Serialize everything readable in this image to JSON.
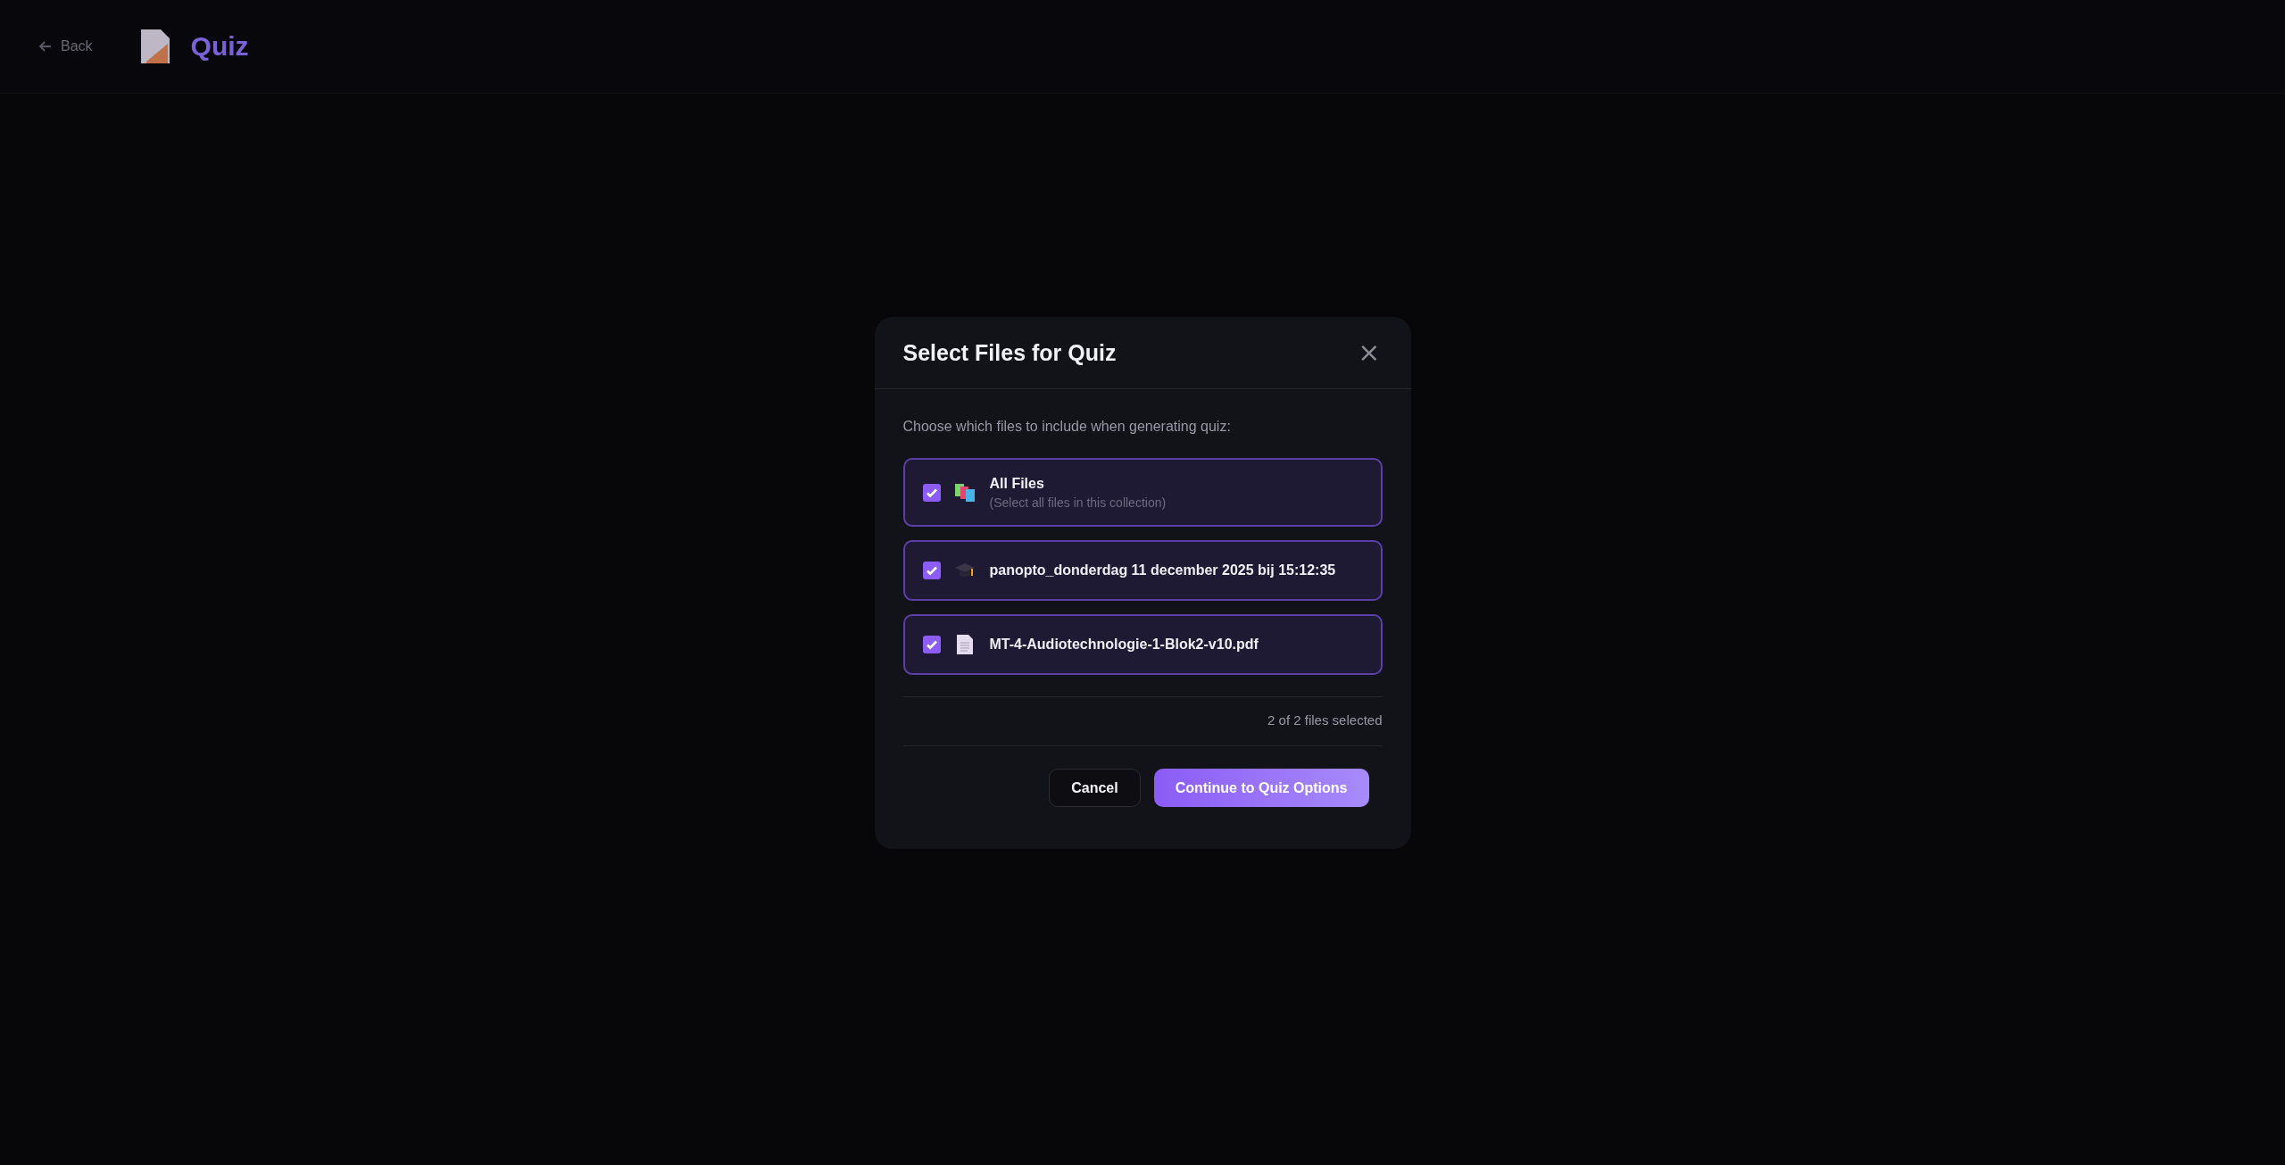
{
  "header": {
    "back": "Back",
    "title": "Quiz"
  },
  "dialog": {
    "title": "Select Files for Quiz",
    "close": "×",
    "description": "Choose which files to include when generating quiz:",
    "files": [
      {
        "kind": "all",
        "name": "All Files",
        "subtitle": "(Select all files in this collection)",
        "checked": true
      },
      {
        "kind": "video",
        "name": "panopto_donderdag 11 december 2025 bij 15:12:35",
        "checked": true
      },
      {
        "kind": "document",
        "name": "MT-4-Audiotechnologie-1-Blok2-v10.pdf",
        "checked": true
      }
    ],
    "count": "2 of 2 files selected",
    "buttons": [
      {
        "kind": "secondary",
        "label": "Cancel"
      },
      {
        "kind": "primary",
        "label": "Continue to Quiz Options"
      }
    ]
  }
}
